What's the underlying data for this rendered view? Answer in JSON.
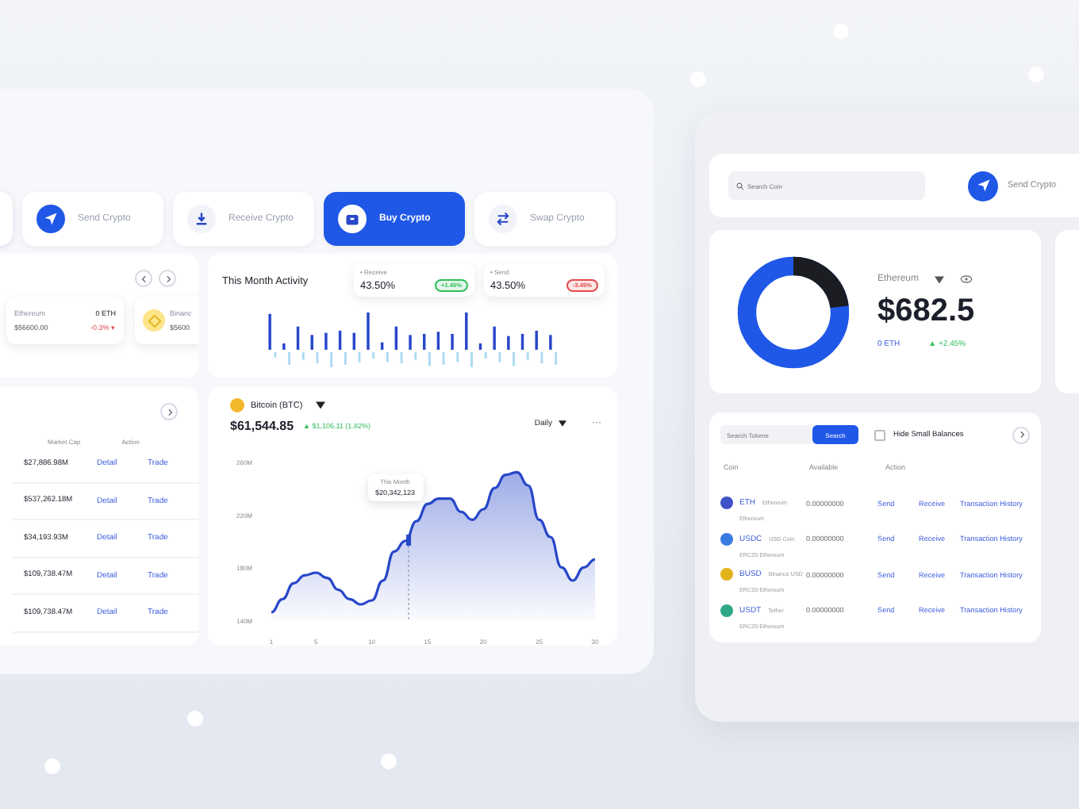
{
  "left_window": {
    "actions": [
      {
        "label": "Send Crypto",
        "kind": "send",
        "selected": false
      },
      {
        "label": "Receive Crypto",
        "kind": "receive",
        "selected": false
      },
      {
        "label": "Buy Crypto",
        "kind": "buy",
        "selected": true
      },
      {
        "label": "Swap Crypto",
        "kind": "swap",
        "selected": false
      }
    ],
    "coins": [
      {
        "name": "Ethereum",
        "price": "$56600.00",
        "amount": "0 ETH",
        "change": "-0.3% ▾",
        "kind": "eth"
      },
      {
        "name": "Binanc",
        "price": "$5600",
        "kind": "bnb"
      }
    ],
    "activity": {
      "title": "This Month Activity",
      "stats": [
        {
          "label": "• Receive",
          "value": "43.50%",
          "badge": "+1.45%",
          "color": "#2fbf5a"
        },
        {
          "label": "• Send",
          "value": "43.50%",
          "badge": "-3.45%",
          "color": "#e5484d"
        }
      ]
    },
    "market": {
      "columns": [
        "Market Cap",
        "Action"
      ],
      "rows": [
        {
          "cap": "$27,886.98M",
          "detail": "Detail",
          "trade": "Trade"
        },
        {
          "cap": "$537,262.18M",
          "detail": "Detail",
          "trade": "Trade"
        },
        {
          "cap": "$34,193.93M",
          "detail": "Detail",
          "trade": "Trade"
        },
        {
          "cap": "$109,738.47M",
          "detail": "Detail",
          "trade": "Trade"
        },
        {
          "cap": "$109,738.47M",
          "detail": "Detail",
          "trade": "Trade"
        }
      ]
    },
    "price": {
      "value": "$61,544.85",
      "change": "▲ $1,106.11 (1.82%)",
      "period": "Daily",
      "menu": "···",
      "tooltip_title": "This Month",
      "tooltip_value": "$20,342,123",
      "chart_data": {
        "type": "area",
        "x": [
          1,
          2,
          3,
          4,
          5,
          6,
          7,
          8,
          9,
          10,
          11,
          12,
          13,
          14,
          15,
          16,
          17,
          18,
          19,
          20,
          21,
          22,
          23,
          24,
          25,
          26,
          27,
          28,
          29,
          30
        ],
        "series": [
          {
            "name": "Bitcoin (BTC)",
            "color": "#2747c9",
            "values": [
              146,
              156,
              168,
              174,
              176,
              172,
              163,
              156,
              152,
              155,
              170,
              192,
              200,
              215,
              228,
              232,
              232,
              222,
              216,
              224,
              240,
              250,
              252,
              242,
              216,
              203,
              180,
              170,
              180,
              186
            ]
          }
        ],
        "xlim": [
          1,
          30
        ],
        "ylim": [
          140,
          260
        ],
        "xticks": [
          1,
          5,
          10,
          15,
          20,
          25,
          30
        ],
        "yticks": [
          {
            "value": 140,
            "label": "140M"
          },
          {
            "value": 180,
            "label": "180M"
          },
          {
            "value": 220,
            "label": "220M"
          },
          {
            "value": 260,
            "label": "260M"
          }
        ]
      }
    }
  },
  "right_window": {
    "search": {
      "placeholder": "Search Coin"
    },
    "send": {
      "label": "Send Crypto"
    },
    "balance": {
      "coin": "Ethereum",
      "value": "$682.5",
      "amount": "0 ETH",
      "change": "▲ +2.45%"
    },
    "tokens": {
      "search": {
        "placeholder": "Search Tokens"
      },
      "button": "Search",
      "hide_small": {
        "label": "Hide Small Balances",
        "checked": false
      },
      "columns": [
        "Coin",
        "Available",
        "Action"
      ],
      "rows": [
        {
          "symbol": "ETH",
          "name": "Ethereum",
          "network": "Ethereum",
          "available": "0.00000000",
          "color": "#3f51c8",
          "actions": [
            "Send",
            "Receive",
            "Transaction History"
          ]
        },
        {
          "symbol": "USDC",
          "name": "USD Coin",
          "network": "ERC20 Ethereum",
          "available": "0.00000000",
          "color": "#3b7be0",
          "actions": [
            "Send",
            "Receive",
            "Transaction History"
          ]
        },
        {
          "symbol": "BUSD",
          "name": "Binance USD",
          "network": "ERC20 Ethereum",
          "available": "0.00000000",
          "color": "#e2b31a",
          "actions": [
            "Send",
            "Receive",
            "Transaction History"
          ]
        },
        {
          "symbol": "USDT",
          "name": "Tether",
          "network": "ERC20 Ethereum",
          "available": "0.00000000",
          "color": "#2fa88a",
          "actions": [
            "Send",
            "Receive",
            "Transaction History"
          ]
        }
      ]
    }
  }
}
